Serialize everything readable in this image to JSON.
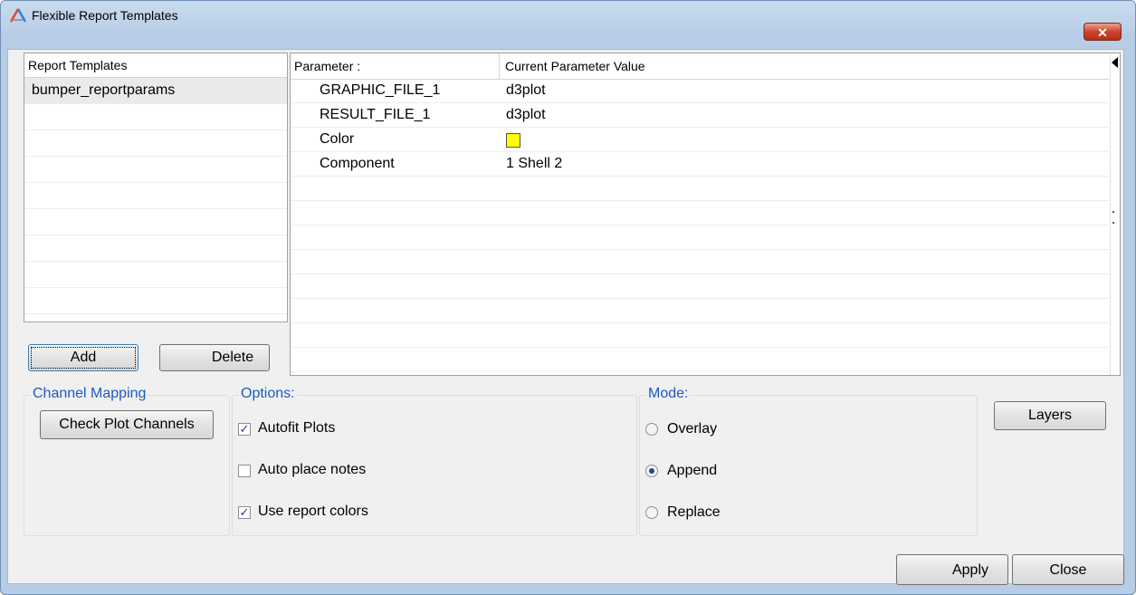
{
  "window": {
    "title": "Flexible Report Templates",
    "close_label": "✕"
  },
  "templates": {
    "header": "Report Templates",
    "items": [
      "bumper_reportparams"
    ],
    "add_label": "Add",
    "delete_label": "Delete"
  },
  "params": {
    "col1": "Parameter :",
    "col2": "Current Parameter Value",
    "rows": [
      {
        "name": "GRAPHIC_FILE_1",
        "value": "d3plot"
      },
      {
        "name": "RESULT_FILE_1",
        "value": "d3plot"
      },
      {
        "name": "Color",
        "value": "",
        "swatch": "#ffff00"
      },
      {
        "name": "Component",
        "value": "1 Shell 2"
      }
    ]
  },
  "channel_mapping": {
    "label": "Channel Mapping",
    "button": "Check Plot Channels"
  },
  "options": {
    "label": "Options:",
    "autofit": {
      "label": "Autofit Plots",
      "checked": true
    },
    "auto_place": {
      "label": "Auto place notes",
      "checked": false
    },
    "report_colors": {
      "label": "Use report colors",
      "checked": true
    }
  },
  "mode": {
    "label": "Mode:",
    "overlay": "Overlay",
    "append": "Append",
    "replace": "Replace",
    "selected": "Append"
  },
  "layers_label": "Layers",
  "apply_label": "Apply",
  "close_label": "Close"
}
